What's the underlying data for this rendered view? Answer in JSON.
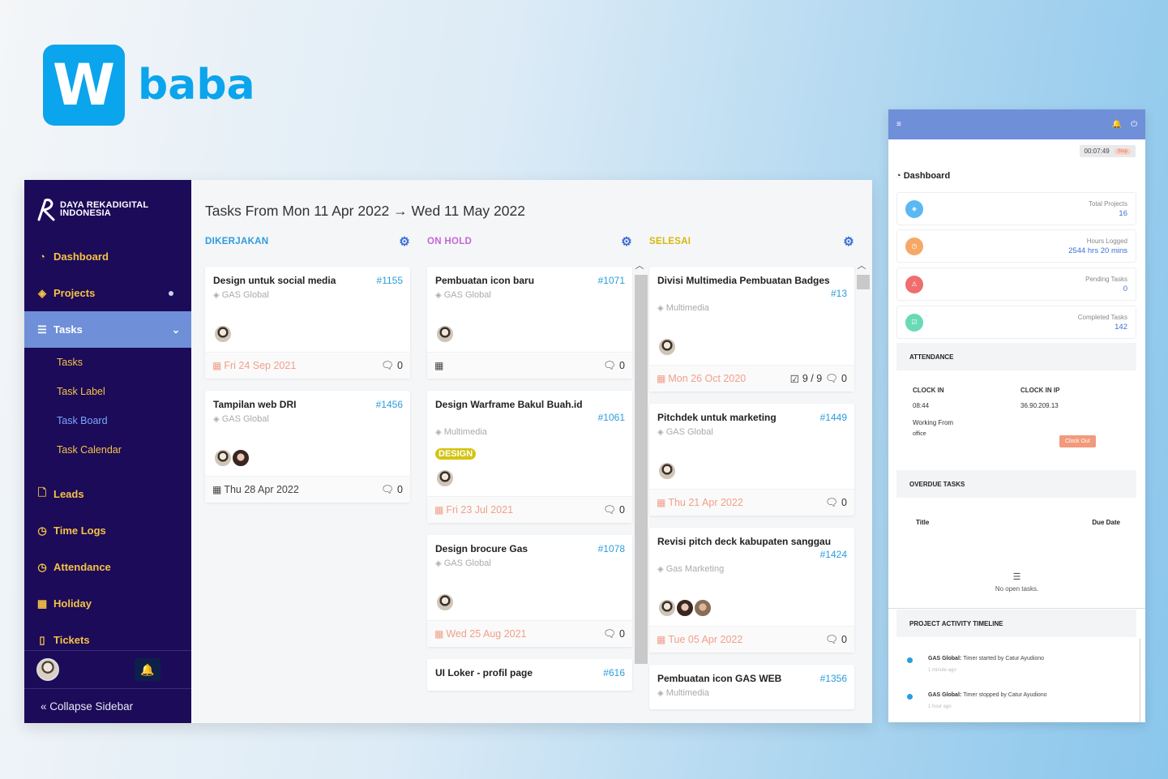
{
  "logo": {
    "mark": "W",
    "text": "baba"
  },
  "sidebar": {
    "brand": [
      "DAYA REKADIGITAL",
      "INDONESIA"
    ],
    "items": [
      {
        "label": "Dashboard",
        "icon": "dashboard-icon"
      },
      {
        "label": "Projects",
        "icon": "layers-icon"
      },
      {
        "label": "Tasks",
        "icon": "tasks-icon"
      },
      {
        "label": "Leads",
        "icon": "file-icon"
      },
      {
        "label": "Time Logs",
        "icon": "clock-icon"
      },
      {
        "label": "Attendance",
        "icon": "clock-icon"
      },
      {
        "label": "Holiday",
        "icon": "calendar-icon"
      },
      {
        "label": "Tickets",
        "icon": "ticket-icon"
      }
    ],
    "sub_items": [
      "Tasks",
      "Task Label",
      "Task Board",
      "Task Calendar"
    ],
    "collapse_label": "Collapse Sidebar"
  },
  "board": {
    "title_from": "Tasks From Mon 11 Apr 2022",
    "title_to": "Wed 11 May 2022",
    "columns": [
      {
        "name": "DIKERJAKAN",
        "color": "#2b9cde",
        "cards": [
          {
            "title": "Design untuk social media",
            "id": "#1155",
            "project": "GAS Global",
            "date": "Fri 24 Sep 2021",
            "late": true,
            "comments": "0",
            "avatars": [
              "av1"
            ]
          },
          {
            "title": "Tampilan web DRI",
            "id": "#1456",
            "project": "GAS Global",
            "date": "Thu 28 Apr 2022",
            "late": false,
            "comments": "0",
            "avatars": [
              "av1",
              "av2"
            ]
          }
        ]
      },
      {
        "name": "ON HOLD",
        "color": "#c466d6",
        "cards": [
          {
            "title": "Pembuatan icon baru",
            "id": "#1071",
            "project": "GAS Global",
            "date": "",
            "late": false,
            "comments": "0",
            "avatars": [
              "av1"
            ]
          },
          {
            "title": "Design Warframe Bakul Buah.id",
            "id": "#1061",
            "project": "Multimedia",
            "badge": "DESIGN",
            "date": "Fri 23 Jul 2021",
            "late": true,
            "comments": "0",
            "avatars": [
              "av1"
            ]
          },
          {
            "title": "Design brocure Gas",
            "id": "#1078",
            "project": "GAS Global",
            "date": "Wed 25 Aug 2021",
            "late": true,
            "comments": "0",
            "avatars": [
              "av1"
            ]
          },
          {
            "title": "UI Loker - profil page",
            "id": "#616",
            "project": "",
            "date": "",
            "late": false,
            "comments": "",
            "avatars": []
          }
        ]
      },
      {
        "name": "SELESAI",
        "color": "#d4b80c",
        "cards": [
          {
            "title": "Divisi Multimedia Pembuatan Badges",
            "id": "#13",
            "project": "Multimedia",
            "date": "Mon 26 Oct 2020",
            "late": true,
            "checklist": "9 / 9",
            "comments": "0",
            "avatars": [
              "av1"
            ]
          },
          {
            "title": "Pitchdek untuk marketing",
            "id": "#1449",
            "project": "GAS Global",
            "date": "Thu 21 Apr 2022",
            "late": true,
            "comments": "0",
            "avatars": [
              "av1"
            ]
          },
          {
            "title": "Revisi pitch deck kabupaten sanggau",
            "id": "#1424",
            "project": "Gas Marketing",
            "date": "Tue 05 Apr 2022",
            "late": true,
            "comments": "0",
            "avatars": [
              "av1",
              "av2",
              "av3"
            ]
          },
          {
            "title": "Pembuatan icon GAS WEB",
            "id": "#1356",
            "project": "Multimedia",
            "date": "",
            "late": false,
            "comments": "",
            "avatars": []
          }
        ]
      }
    ]
  },
  "mobile": {
    "timer": "00:07:49",
    "stop_label": "Stop",
    "dashboard_title": "Dashboard",
    "stats": [
      {
        "label": "Total Projects",
        "value": "16",
        "color": "#5ab8f2"
      },
      {
        "label": "Hours Logged",
        "value": "2544 hrs 20 mins",
        "color": "#f7a866"
      },
      {
        "label": "Pending Tasks",
        "value": "0",
        "color": "#f06d6d"
      },
      {
        "label": "Completed Tasks",
        "value": "142",
        "color": "#69d9b6"
      }
    ],
    "attendance": {
      "heading": "ATTENDANCE",
      "clock_in_label": "CLOCK IN",
      "clock_in_value": "08:44",
      "clock_in_ip_label": "CLOCK IN IP",
      "clock_in_ip_value": "36.90.209.13",
      "working_from_label": "Working From",
      "working_from_value": "office",
      "clock_out_label": "Clock Out"
    },
    "overdue": {
      "heading": "OVERDUE TASKS",
      "col_title": "Title",
      "col_due": "Due Date",
      "empty": "No open tasks."
    },
    "activity": {
      "heading": "PROJECT ACTIVITY TIMELINE",
      "items": [
        {
          "project": "GAS Global:",
          "text": "Timer started by Catur Ayudiono",
          "ago": "1 minute ago"
        },
        {
          "project": "GAS Global:",
          "text": "Timer stopped by Catur Ayudiono",
          "ago": "1 hour ago"
        }
      ]
    }
  }
}
